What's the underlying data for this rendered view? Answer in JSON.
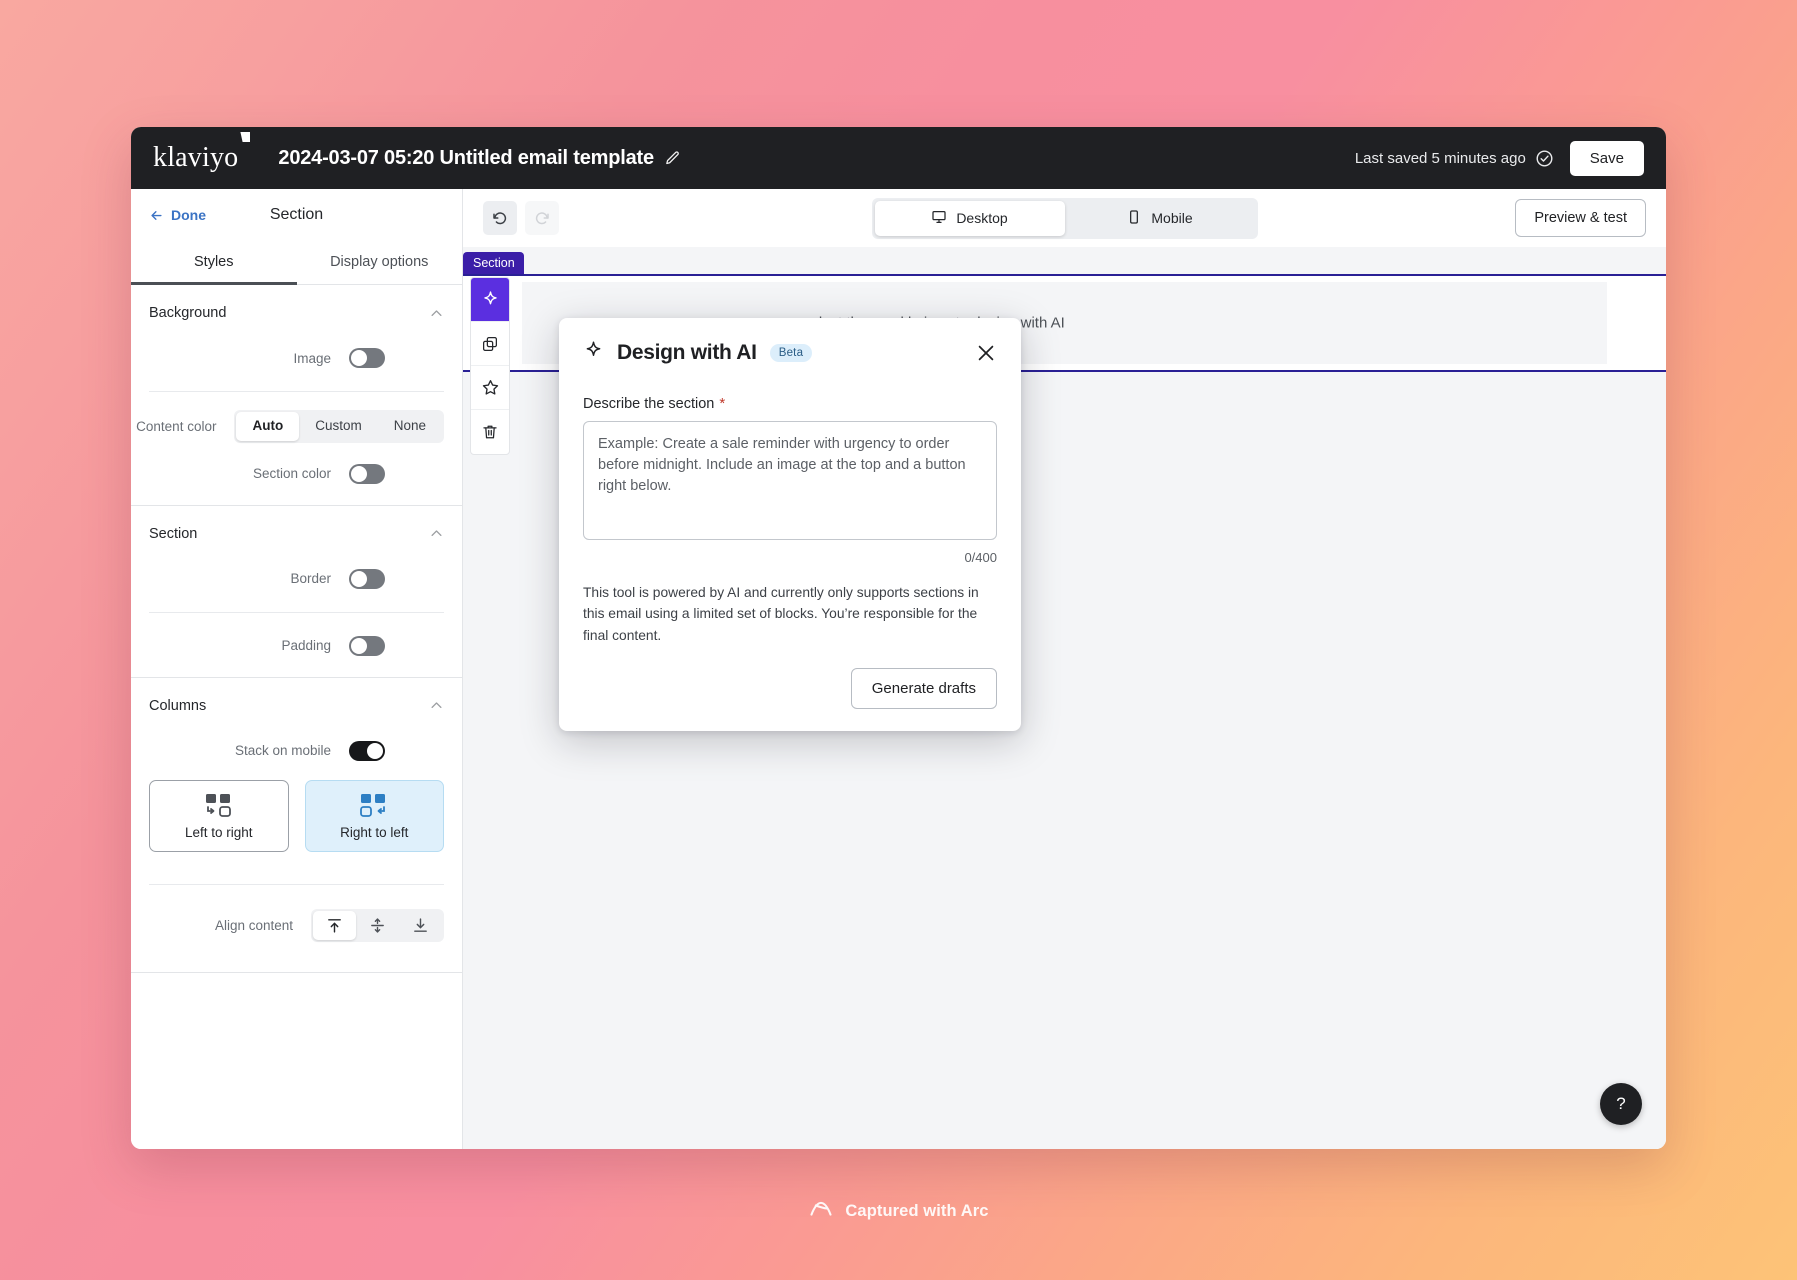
{
  "topbar": {
    "logo_text": "klaviyo",
    "document_title": "2024-03-07 05:20 Untitled email template",
    "edit_icon": "pencil-icon",
    "saved_status": "Last saved 5 minutes ago",
    "saved_icon": "check-circle-icon",
    "save_label": "Save"
  },
  "sidebar": {
    "done_label": "Done",
    "panel_title": "Section",
    "tabs": [
      {
        "label": "Styles",
        "active": true
      },
      {
        "label": "Display options",
        "active": false
      }
    ],
    "groups": [
      {
        "title": "Background",
        "rows": [
          {
            "label": "Image",
            "control": "toggle",
            "state": "off"
          },
          {
            "label": "Content color",
            "control": "segmented",
            "options": [
              "Auto",
              "Custom",
              "None"
            ],
            "selected": "Auto"
          },
          {
            "label": "Section color",
            "control": "toggle",
            "state": "off"
          }
        ]
      },
      {
        "title": "Section",
        "rows": [
          {
            "label": "Border",
            "control": "toggle",
            "state": "off"
          },
          {
            "label": "Padding",
            "control": "toggle",
            "state": "off"
          }
        ]
      },
      {
        "title": "Columns",
        "rows": [
          {
            "label": "Stack on mobile",
            "control": "toggle",
            "state": "on"
          }
        ],
        "cards": [
          {
            "caption": "Left to right",
            "selected": false
          },
          {
            "caption": "Right to left",
            "selected": true
          }
        ],
        "align": {
          "label": "Align content",
          "options": [
            "align-top-icon",
            "align-middle-icon",
            "align-bottom-icon"
          ],
          "selected": "align-top-icon"
        }
      }
    ]
  },
  "canvas": {
    "undo_icon": "undo-icon",
    "redo_icon": "redo-icon",
    "device_options": [
      {
        "label": "Desktop",
        "icon": "desktop-icon",
        "selected": true
      },
      {
        "label": "Mobile",
        "icon": "mobile-icon",
        "selected": false
      }
    ],
    "preview_label": "Preview & test",
    "section_badge": "Section",
    "section_hint": "select the sparkle icon to design with AI",
    "block_tools": [
      {
        "icon": "sparkle-icon",
        "active": true
      },
      {
        "icon": "duplicate-icon",
        "active": false
      },
      {
        "icon": "star-icon",
        "active": false
      },
      {
        "icon": "trash-icon",
        "active": false
      }
    ],
    "help_label": "?",
    "accent_purple": "#5b2fe0",
    "section_border": "#2a2095"
  },
  "modal": {
    "sparkle_icon": "sparkle-icon",
    "title": "Design with AI",
    "badge": "Beta",
    "close_icon": "close-icon",
    "field_label": "Describe the section",
    "required_mark": "*",
    "textarea_value": "",
    "textarea_placeholder": "Example: Create a sale reminder with urgency to order before midnight. Include an image at the top and a button right below.",
    "counter": "0/400",
    "helper_text": "This tool is powered by AI and currently only supports sections in this email using a limited set of blocks. You’re responsible for the final content.",
    "submit_label": "Generate drafts"
  },
  "watermark": {
    "text": "Captured with Arc",
    "icon": "arc-logo-icon"
  }
}
